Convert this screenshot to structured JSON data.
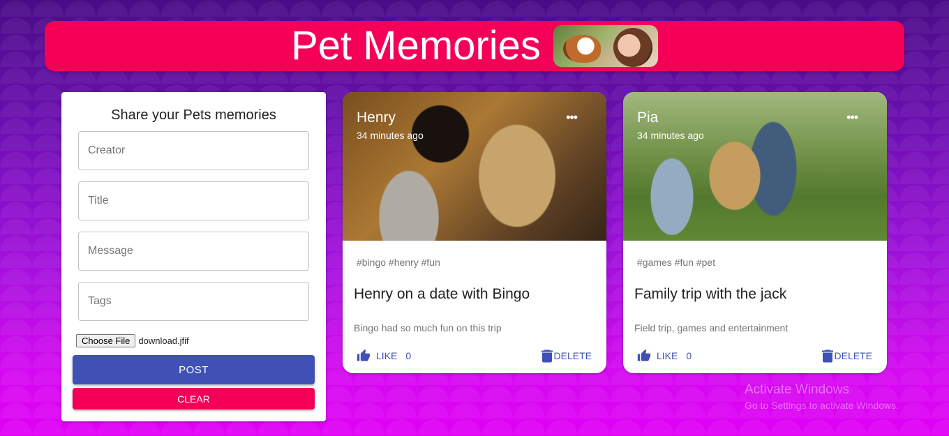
{
  "header": {
    "title": "Pet Memories",
    "logo_icon": "dog-kiss-photo"
  },
  "form": {
    "title": "Share your Pets memories",
    "fields": {
      "creator_placeholder": "Creator",
      "title_placeholder": "Title",
      "message_placeholder": "Message",
      "tags_placeholder": "Tags"
    },
    "file": {
      "button_label": "Choose File",
      "filename": "download.jfif"
    },
    "post_label": "POST",
    "clear_label": "CLEAR"
  },
  "posts": [
    {
      "creator": "Henry",
      "time": "34 minutes ago",
      "tags": "#bingo #henry #fun",
      "title": "Henry on a date with Bingo",
      "message": "Bingo had so much fun on this trip",
      "like_label": "LIKE",
      "like_count": "0",
      "delete_label": "DELETE"
    },
    {
      "creator": "Pia",
      "time": "34 minutes ago",
      "tags": "#games #fun #pet",
      "title": "Family trip with the jack",
      "message": "Field trip, games and entertainment",
      "like_label": "LIKE",
      "like_count": "0",
      "delete_label": "DELETE"
    }
  ],
  "watermark": {
    "line1": "Activate Windows",
    "line2": "Go to Settings to activate Windows."
  },
  "colors": {
    "primary": "#3f51b5",
    "secondary": "#f50057"
  }
}
